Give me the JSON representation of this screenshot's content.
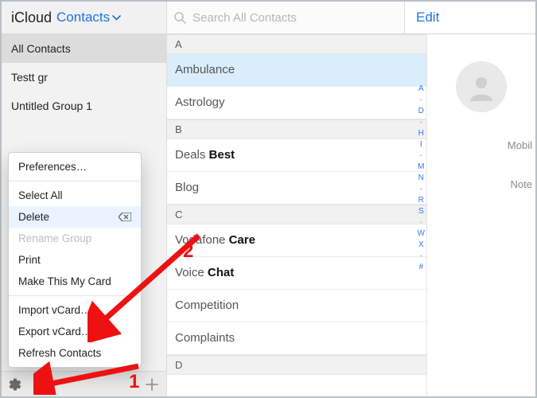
{
  "header": {
    "brand": "iCloud",
    "switcher_label": "Contacts",
    "search_placeholder": "Search All Contacts",
    "edit_label": "Edit"
  },
  "sidebar": {
    "items": [
      {
        "label": "All Contacts",
        "selected": true
      },
      {
        "label": "Testt gr",
        "selected": false
      },
      {
        "label": "Untitled Group 1",
        "selected": false
      }
    ]
  },
  "contact_list": {
    "sections": [
      {
        "letter": "A",
        "rows": [
          {
            "first": "Ambulance",
            "last": "",
            "selected": true
          },
          {
            "first": "Astrology",
            "last": "",
            "selected": false
          }
        ]
      },
      {
        "letter": "B",
        "rows": [
          {
            "first": "Deals",
            "last": "Best",
            "selected": false
          },
          {
            "first": "Blog",
            "last": "",
            "selected": false
          }
        ]
      },
      {
        "letter": "C",
        "rows": [
          {
            "first": "Vodafone",
            "last": "Care",
            "selected": false
          },
          {
            "first": "Voice",
            "last": "Chat",
            "selected": false
          },
          {
            "first": "Competition",
            "last": "",
            "selected": false
          },
          {
            "first": "Complaints",
            "last": "",
            "selected": false
          }
        ]
      },
      {
        "letter": "D",
        "rows": []
      }
    ]
  },
  "index_letters": [
    "A",
    "·",
    "D",
    "·",
    "H",
    "I",
    "·",
    "M",
    "N",
    "·",
    "R",
    "S",
    "·",
    "W",
    "X",
    "·",
    "#"
  ],
  "detail": {
    "fields": [
      "Mobil",
      "Note"
    ]
  },
  "actions_menu": {
    "items": [
      {
        "label": "Preferences…",
        "enabled": true,
        "selected": false,
        "sep_after": true
      },
      {
        "label": "Select All",
        "enabled": true,
        "selected": false
      },
      {
        "label": "Delete",
        "enabled": true,
        "selected": true,
        "icon": "erase"
      },
      {
        "label": "Rename Group",
        "enabled": false,
        "selected": false
      },
      {
        "label": "Print",
        "enabled": true,
        "selected": false
      },
      {
        "label": "Make This My Card",
        "enabled": true,
        "selected": false,
        "sep_after": true
      },
      {
        "label": "Import vCard…",
        "enabled": true,
        "selected": false
      },
      {
        "label": "Export vCard…",
        "enabled": true,
        "selected": false
      },
      {
        "label": "Refresh Contacts",
        "enabled": true,
        "selected": false
      }
    ]
  },
  "annotations": {
    "n1": "1",
    "n2": "2"
  }
}
